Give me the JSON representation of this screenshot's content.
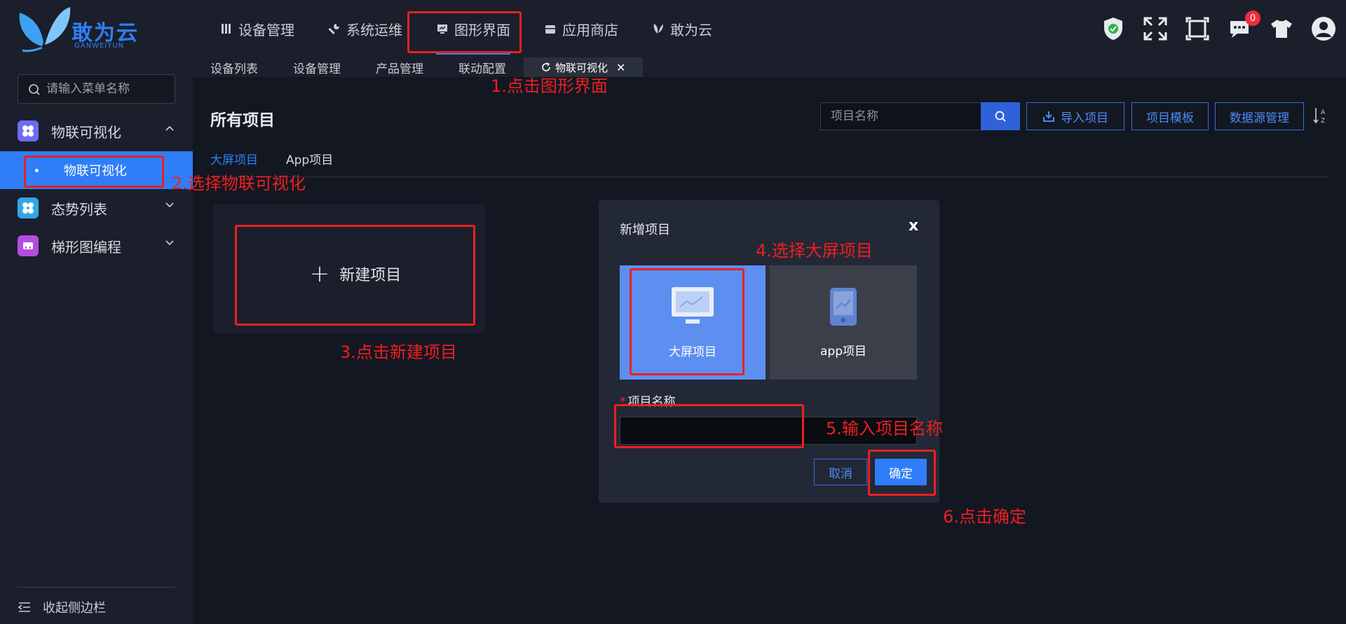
{
  "brand": {
    "name": "敢为云",
    "sub": "GANWEIYUN",
    "color": "#2f7ef7"
  },
  "nav": [
    {
      "label": "设备管理",
      "icon": "book-icon"
    },
    {
      "label": "系统运维",
      "icon": "wrench-icon"
    },
    {
      "label": "图形界面",
      "icon": "monitor-icon",
      "active": true
    },
    {
      "label": "应用商店",
      "icon": "store-icon"
    },
    {
      "label": "敢为云",
      "icon": "butterfly-icon"
    }
  ],
  "top_icons": [
    "shield-icon",
    "fullscreen-icon",
    "frame-icon",
    "message-icon",
    "shirt-icon",
    "user-avatar-icon"
  ],
  "message_badge": "0",
  "tabs": [
    {
      "label": "设备列表"
    },
    {
      "label": "设备管理"
    },
    {
      "label": "产品管理"
    },
    {
      "label": "联动配置"
    },
    {
      "label": "物联可视化",
      "active": true
    }
  ],
  "sidebar": {
    "search_placeholder": "请输入菜单名称",
    "groups": [
      {
        "label": "物联可视化",
        "icon": "grid-icon",
        "color": "#6c6cf2",
        "expanded": true
      },
      {
        "label": "态势列表",
        "icon": "grid-icon",
        "color": "#2fa8e8",
        "expanded": false
      },
      {
        "label": "梯形图编程",
        "icon": "ladder-icon",
        "color": "#b44ce0",
        "expanded": false
      }
    ],
    "active_sub": "物联可视化",
    "collapse_label": "收起侧边栏"
  },
  "main": {
    "title": "所有项目",
    "search_placeholder": "项目名称",
    "buttons": {
      "import": "导入项目",
      "template": "项目模板",
      "datasource": "数据源管理"
    },
    "subtabs": [
      {
        "label": "大屏项目",
        "active": true
      },
      {
        "label": "App项目"
      }
    ],
    "new_project": "新建项目"
  },
  "modal": {
    "title": "新增项目",
    "close": "x",
    "types": [
      {
        "label": "大屏项目",
        "selected": true
      },
      {
        "label": "app项目"
      }
    ],
    "field_label": "项目名称",
    "field_value": "",
    "cancel": "取消",
    "ok": "确定"
  },
  "annotations": [
    "1.点击图形界面",
    "2.选择物联可视化",
    "3.点击新建项目",
    "4.选择大屏项目",
    "5.输入项目名称",
    "6.点击确定"
  ],
  "annotation_color": "#ee1f1f"
}
